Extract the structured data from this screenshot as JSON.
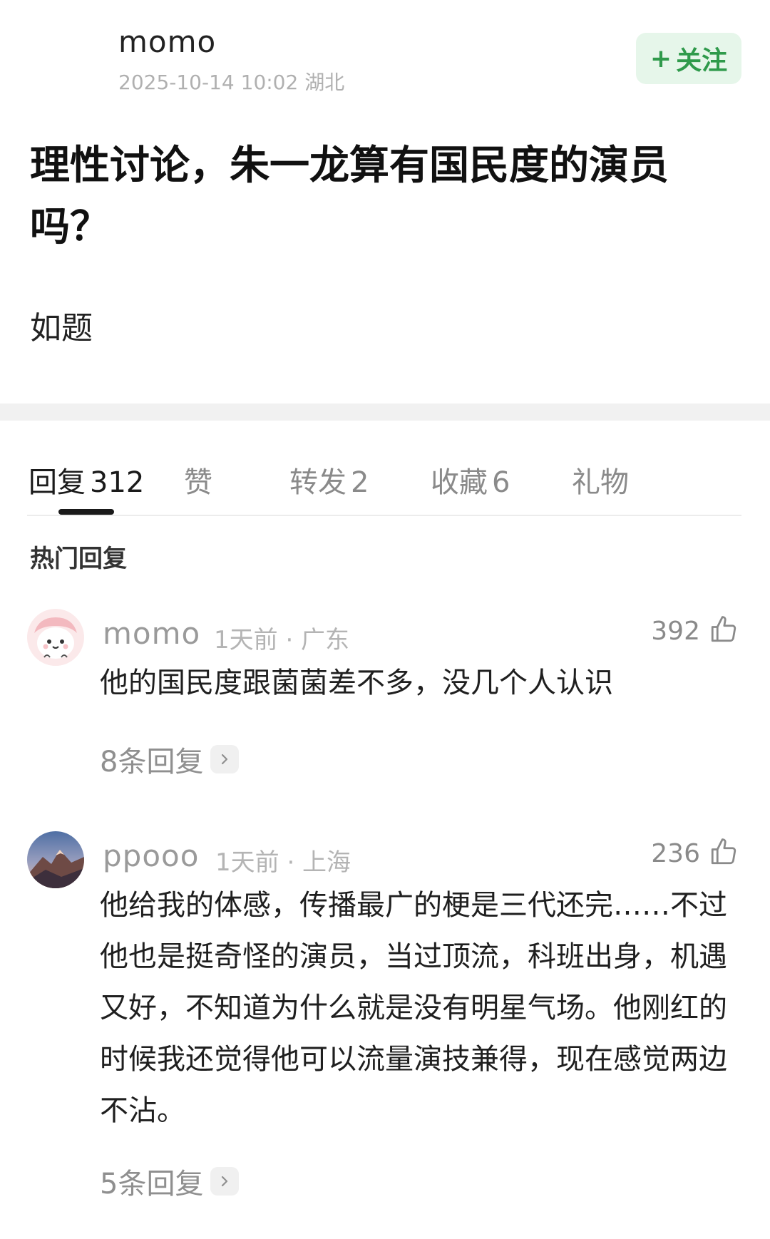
{
  "post": {
    "author": "momo",
    "meta": "2025-10-14 10:02  湖北",
    "follow_label": "关注",
    "title": "理性讨论，朱一龙算有国民度的演员吗？",
    "content": "如题"
  },
  "tabs": [
    {
      "label": "回复",
      "count": "312"
    },
    {
      "label": "赞",
      "count": ""
    },
    {
      "label": "转发",
      "count": "2"
    },
    {
      "label": "收藏",
      "count": "6"
    },
    {
      "label": "礼物",
      "count": ""
    }
  ],
  "hot_replies_label": "热门回复",
  "comments": [
    {
      "name": "momo",
      "meta": "1天前 · 广东",
      "likes": "392",
      "text": "他的国民度跟菌菌差不多，没几个人认识",
      "replies": "8条回复"
    },
    {
      "name": "ppooo",
      "meta": "1天前 · 上海",
      "likes": "236",
      "text": "他给我的体感，传播最广的梗是三代还完……不过他也是挺奇怪的演员，当过顶流，科班出身，机遇又好，不知道为什么就是没有明星气场。他刚红的时候我还觉得他可以流量演技兼得，现在感觉两边不沾。",
      "replies": "5条回复"
    }
  ],
  "colors": {
    "follow_bg": "#e6f6ea",
    "follow_text": "#2f9a4b",
    "muted": "#8a8a8a",
    "divider": "#f1f1f1"
  },
  "icons": {
    "like": "thumbs-up-icon",
    "more_replies": "chevron-right-icon",
    "follow_plus": "plus-icon"
  }
}
